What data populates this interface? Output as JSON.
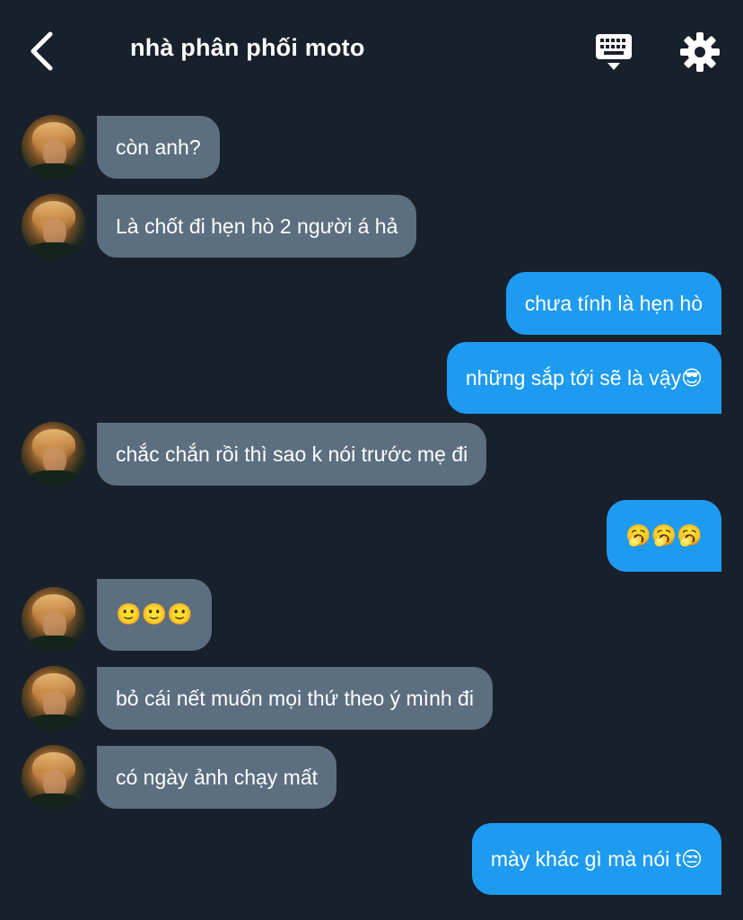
{
  "header": {
    "title": "nhà phân phối moto",
    "back_icon": "chevron-left-icon",
    "keyboard_icon": "keyboard-icon",
    "settings_icon": "gear-icon"
  },
  "colors": {
    "background": "#18202b",
    "incoming_bubble": "#5c6f80",
    "outgoing_bubble": "#1d9bf0"
  },
  "messages": [
    {
      "direction": "in",
      "text": "còn anh?"
    },
    {
      "direction": "in",
      "text": "Là chốt đi hẹn hò 2 người á hả"
    },
    {
      "direction": "out",
      "text": "chưa tính là hẹn hò"
    },
    {
      "direction": "out",
      "text": "những sắp tới sẽ là vậy😎"
    },
    {
      "direction": "in",
      "text": "chắc chắn rồi thì sao k nói trước mẹ đi"
    },
    {
      "direction": "out",
      "text": "🥱🥱🥱"
    },
    {
      "direction": "in",
      "text": "🙂🙂🙂"
    },
    {
      "direction": "in",
      "text": "bỏ cái nết muốn mọi thứ theo ý mình đi"
    },
    {
      "direction": "in",
      "text": "có ngày ảnh chạy mất"
    },
    {
      "direction": "out",
      "text": "mày khác gì mà nói t😒"
    }
  ]
}
